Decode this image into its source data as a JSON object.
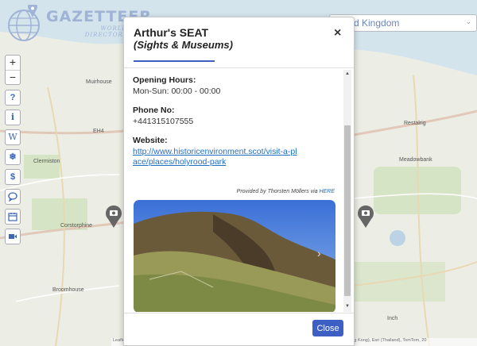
{
  "app": {
    "logo_title": "GAZETTEER",
    "logo_subtitle_line1": "WORLD",
    "logo_subtitle_line2": "DIRECTORY",
    "country_select_value": "d Kingdom"
  },
  "map": {
    "zoom_in": "+",
    "zoom_out": "−",
    "labels": {
      "muirhouse": "Muirhouse",
      "clermiston": "Clermiston",
      "corstorphine": "Corstorphine",
      "broomhouse": "Broomhouse",
      "eh4": "EH4",
      "restalrig": "Restalrig",
      "meadowbank": "Meadowbank",
      "inch": "Inch"
    },
    "attribution": "Leaflet | Tiles © Esri — Source: Esri, DeLorme, NAVTEQ, USGS, Intermap, iPC, NRCAN, Esri Japan, METI, Esri China (Hong Kong), Esri (Thailand), TomTom, 20",
    "toolbar": [
      {
        "name": "help",
        "glyph": "?",
        "icon": "question-icon"
      },
      {
        "name": "info",
        "glyph": "i",
        "icon": "info-icon"
      },
      {
        "name": "wikipedia",
        "glyph": "W",
        "icon": "wikipedia-icon"
      },
      {
        "name": "weather",
        "glyph": "❄",
        "icon": "snowflake-icon"
      },
      {
        "name": "currency",
        "glyph": "$",
        "icon": "dollar-icon"
      },
      {
        "name": "chat",
        "glyph": "",
        "icon": "speech-bubble-icon"
      },
      {
        "name": "calendar",
        "glyph": "",
        "icon": "calendar-icon"
      },
      {
        "name": "video",
        "glyph": "",
        "icon": "video-camera-icon"
      }
    ]
  },
  "modal": {
    "title": "Arthur's SEAT",
    "subtitle": "(Sights & Museums)",
    "close_icon": "×",
    "opening_hours_label": "Opening Hours:",
    "opening_hours_value": "Mon-Sun: 00:00 - 00:00",
    "phone_label": "Phone No:",
    "phone_value": "+441315107555",
    "website_label": "Website:",
    "website_url": "http://www.historicenvironment.scot/visit-a-place/places/holyrood-park",
    "provided_by_text": "Provided by Thorsten Möllers via ",
    "provided_by_link": "HERE",
    "photo_next": "›",
    "scroll_up": "▲",
    "scroll_down": "▼",
    "close_button": "Close"
  },
  "colors": {
    "accent": "#3d5fc4",
    "link": "#1f6fc4",
    "marker": "#666666"
  }
}
